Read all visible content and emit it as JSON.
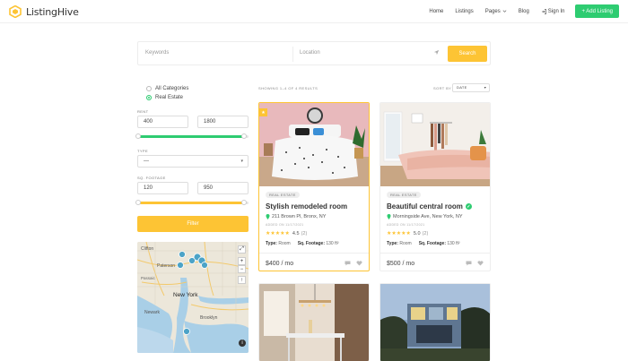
{
  "header": {
    "logo_text": "ListingHive",
    "nav": [
      {
        "label": "Home"
      },
      {
        "label": "Listings"
      },
      {
        "label": "Pages"
      },
      {
        "label": "Blog"
      },
      {
        "label": "Sign In"
      }
    ],
    "add_button": "+ Add Listing"
  },
  "search": {
    "keywords_placeholder": "Keywords",
    "location_placeholder": "Location",
    "button": "Search"
  },
  "sidebar": {
    "categories": [
      {
        "label": "All Categories",
        "checked": false
      },
      {
        "label": "Real Estate",
        "checked": true
      }
    ],
    "rent": {
      "label": "RENT",
      "min": "400",
      "max": "1800"
    },
    "type": {
      "label": "TYPE",
      "value": "—"
    },
    "sq_footage": {
      "label": "SQ. FOOTAGE",
      "min": "120",
      "max": "950"
    },
    "filter_button": "Filter",
    "map": {
      "labels": [
        "Clifton",
        "Paterson",
        "Passaic",
        "New York",
        "Newark",
        "Brooklyn"
      ]
    }
  },
  "results": {
    "count_text": "SHOWING 1–4 OF 4 RESULTS",
    "sort_label": "SORT BY",
    "sort_value": "DATE"
  },
  "listings": [
    {
      "category": "REAL ESTATE",
      "title": "Stylish remodeled room",
      "address": "211 Brown Pl, Bronx, NY",
      "added": "ADDED ON 11/17/2021",
      "rating": "4.5",
      "reviews": "(2)",
      "type_label": "Type:",
      "type_value": "Room",
      "sq_label": "Sq. Footage:",
      "sq_value": "130 ft²",
      "price": "$400 / mo",
      "featured": true,
      "verified": false
    },
    {
      "category": "REAL ESTATE",
      "title": "Beautiful central room",
      "address": "Morningside Ave, New York, NY",
      "added": "ADDED ON 11/17/2021",
      "rating": "5.0",
      "reviews": "(2)",
      "type_label": "Type:",
      "type_value": "Room",
      "sq_label": "Sq. Footage:",
      "sq_value": "130 ft²",
      "price": "$500 / mo",
      "featured": false,
      "verified": true
    }
  ],
  "colors": {
    "accent_yellow": "#fdc434",
    "accent_green": "#2ecc71"
  }
}
